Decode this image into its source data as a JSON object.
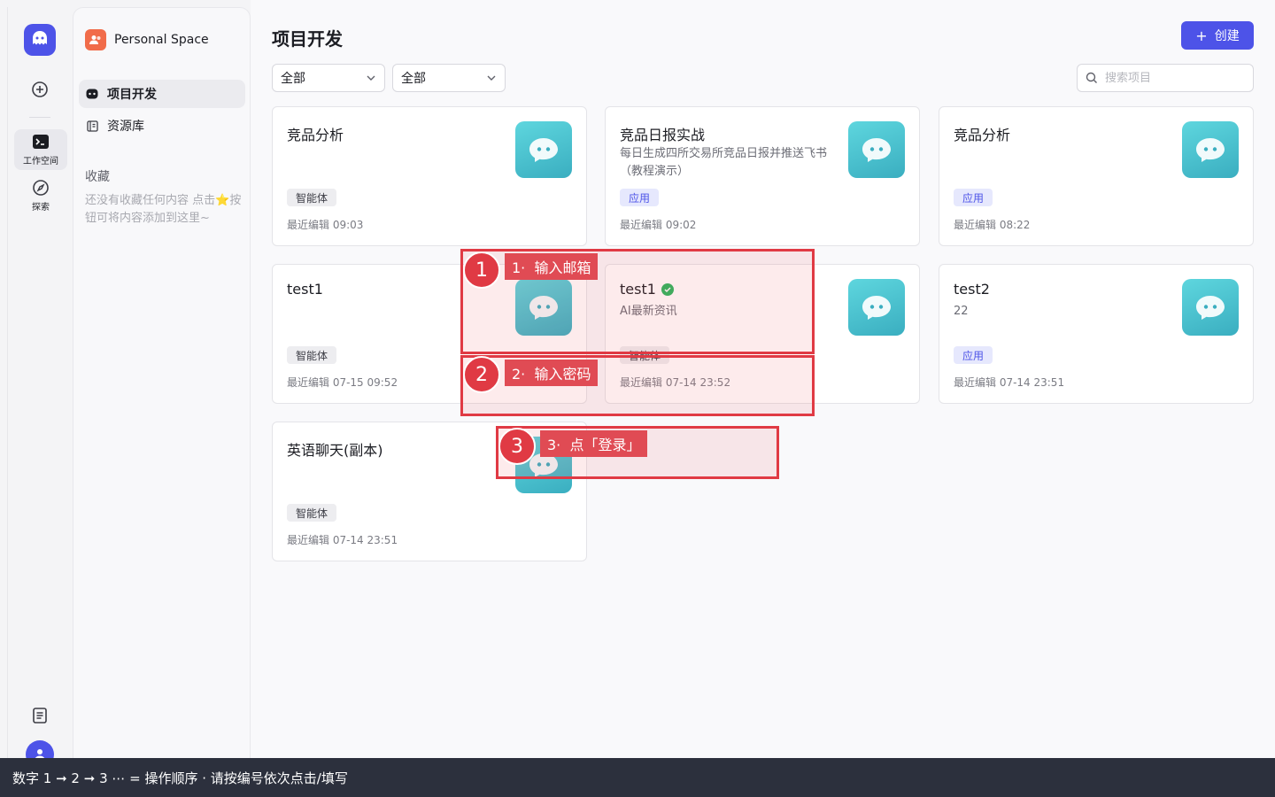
{
  "sidebar_rail": {
    "items": [
      {
        "label": "工作空间",
        "icon": "terminal-icon",
        "active": true
      },
      {
        "label": "探索",
        "icon": "compass-icon",
        "active": false
      }
    ]
  },
  "sidebar": {
    "space_name": "Personal Space",
    "nav": [
      {
        "label": "项目开发",
        "active": true
      },
      {
        "label": "资源库",
        "active": false
      }
    ],
    "favorites_title": "收藏",
    "favorites_empty": "还没有收藏任何内容 点击⭐按钮可将内容添加到这里~"
  },
  "main": {
    "title": "项目开发",
    "create_label": "创建",
    "filter1": "全部",
    "filter2": "全部",
    "search_placeholder": "搜索项目"
  },
  "cards": [
    {
      "name": "竞品分析",
      "desc": "",
      "tag": "智能体",
      "tag_type": "agent",
      "time": "最近编辑 09:03",
      "verified": false
    },
    {
      "name": "竞品日报实战",
      "desc": "每日生成四所交易所竞品日报并推送飞书（教程演示）",
      "tag": "应用",
      "tag_type": "app",
      "time": "最近编辑 09:02",
      "verified": false
    },
    {
      "name": "竞品分析",
      "desc": "",
      "tag": "应用",
      "tag_type": "app",
      "time": "最近编辑 08:22",
      "verified": false
    },
    {
      "name": "test1",
      "desc": "",
      "tag": "智能体",
      "tag_type": "agent",
      "time": "最近编辑 07-15 09:52",
      "verified": false
    },
    {
      "name": "test1",
      "desc": "AI最新资讯",
      "tag": "智能体",
      "tag_type": "agent",
      "time": "最近编辑 07-14 23:52",
      "verified": true
    },
    {
      "name": "test2",
      "desc": "22",
      "tag": "应用",
      "tag_type": "app",
      "time": "最近编辑 07-14 23:51",
      "verified": false
    },
    {
      "name": "英语聊天(副本)",
      "desc": "",
      "tag": "智能体",
      "tag_type": "agent",
      "time": "最近编辑 07-14 23:51",
      "verified": false
    }
  ],
  "annotations": [
    {
      "number": "1",
      "text": "1·  输入邮箱"
    },
    {
      "number": "2",
      "text": "2·  输入密码"
    },
    {
      "number": "3",
      "text": "3·  点「登录」"
    }
  ],
  "footer": "数字 1 ➞ 2 ➞ 3 ⋯ = 操作顺序 ·   请按编号依次点击/填写",
  "colors": {
    "accent": "#4d53e8",
    "annotation": "#e03a44",
    "verified": "#2ab55d"
  }
}
